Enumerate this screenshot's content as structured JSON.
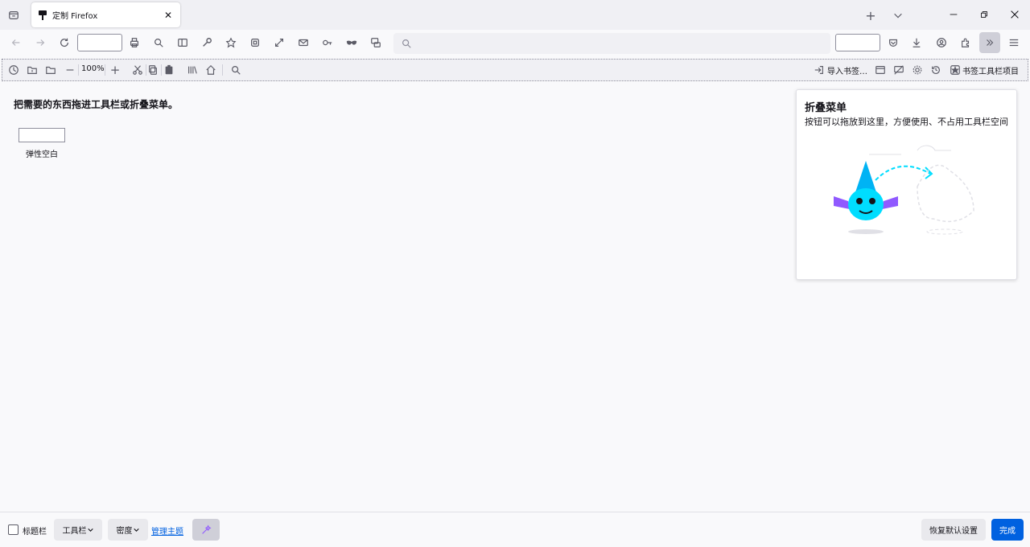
{
  "tab": {
    "title": "定制 Firefox"
  },
  "bookmarks_toolbar": {
    "zoom_level": "100%",
    "import_label": "导入书签…",
    "bookmarks_items_label": "书签工具栏项目"
  },
  "palette": {
    "hint": "把需要的东西拖进工具栏或折叠菜单。",
    "flexible_space_label": "弹性空白"
  },
  "overflow_panel": {
    "title": "折叠菜单",
    "description": "按钮可以拖放到这里，方便使用、不占用工具栏空间"
  },
  "footer": {
    "title_bar_label": "标题栏",
    "toolbars_label": "工具栏",
    "density_label": "密度",
    "manage_themes_label": "管理主题",
    "restore_label": "恢复默认设置",
    "done_label": "完成"
  },
  "colors": {
    "accent": "#0061e0",
    "chrome_bg": "#f0f0f4",
    "content_bg": "#f9f9fb"
  }
}
